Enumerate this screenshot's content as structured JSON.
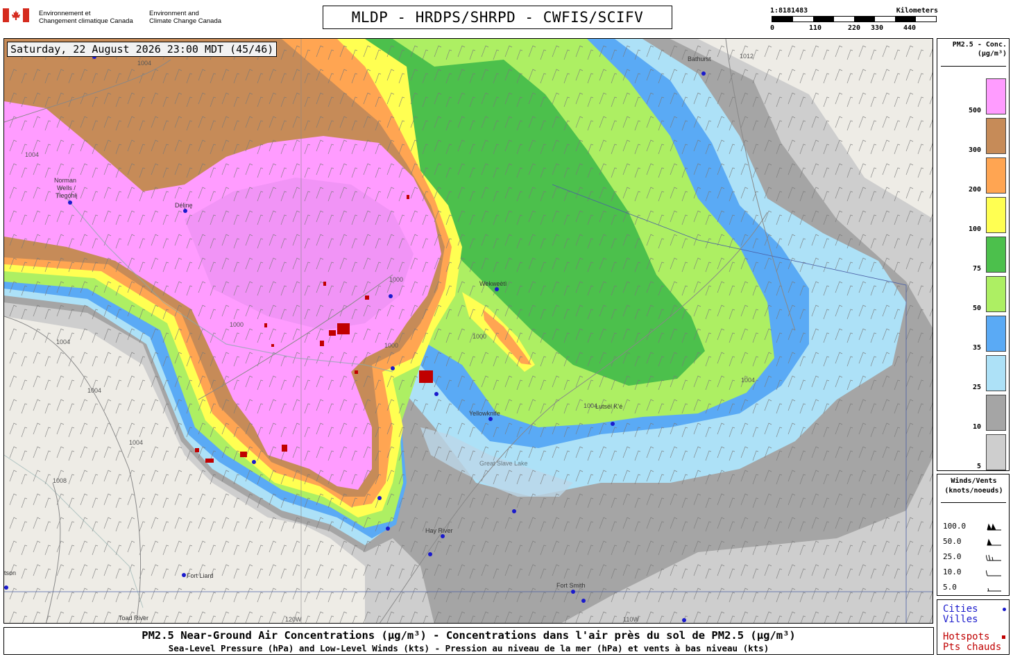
{
  "header": {
    "gov_fr_line1": "Environnement et",
    "gov_fr_line2": "Changement climatique Canada",
    "gov_en_line1": "Environment and",
    "gov_en_line2": "Climate Change Canada",
    "title": "MLDP - HRDPS/SHRPD - CWFIS/SCIFV"
  },
  "scale": {
    "ratio": "1:8181483",
    "unit": "Kilometers",
    "ticks": [
      "0",
      "110",
      "220",
      "330",
      "440"
    ]
  },
  "map": {
    "datetime": "Saturday, 22 August 2026 23:00 MDT (45/46)",
    "cities": [
      {
        "name": "Norman Wells / Tłegóhłį",
        "name_line1": "Norman",
        "name_line2": "Wells /",
        "name_line3": "Tłegóhłį"
      },
      {
        "name": "Délįnę",
        "label": "Délįnę"
      },
      {
        "name": "Wekweètì",
        "label": "Wekweètì"
      },
      {
        "name": "Yellowknife",
        "label": "Yellowknife"
      },
      {
        "name": "Łutsël K'é",
        "label": "Łutsël K'é"
      },
      {
        "name": "Hay River",
        "label": "Hay River"
      },
      {
        "name": "Fort Liard",
        "label": "Fort Liard"
      },
      {
        "name": "Fort Smith",
        "label": "Fort Smith"
      },
      {
        "name": "Bathurst Inlet",
        "label": "Bathurst"
      },
      {
        "name": "Watson Lake",
        "label": "tson"
      },
      {
        "name": "Toad River",
        "label": "Toad River"
      },
      {
        "name": "Great Slave Lake",
        "label": "Great Slave Lake"
      }
    ],
    "isobars": [
      "1004",
      "1000",
      "1008",
      "1012"
    ],
    "meridian_label": "120W",
    "meridian_label2": "110W"
  },
  "legend_pm": {
    "title_line1": "PM2.5 - Conc.",
    "title_line2": "(µg/m³)",
    "bins": [
      {
        "label": "500",
        "color": "#ff9cff"
      },
      {
        "label": "300",
        "color": "#c68b58"
      },
      {
        "label": "200",
        "color": "#ffa552"
      },
      {
        "label": "100",
        "color": "#ffff52"
      },
      {
        "label": "75",
        "color": "#4cc04c"
      },
      {
        "label": "50",
        "color": "#adef63"
      },
      {
        "label": "35",
        "color": "#5aaaf5"
      },
      {
        "label": "25",
        "color": "#ade1f7"
      },
      {
        "label": "10",
        "color": "#a5a5a5"
      },
      {
        "label": "5",
        "color": "#cecece"
      }
    ]
  },
  "legend_wind": {
    "title_line1": "Winds/Vents",
    "title_line2": "(knots/noeuds)",
    "rows": [
      "100.0",
      "50.0",
      "25.0",
      "10.0",
      "5.0"
    ]
  },
  "legend_markers": {
    "cities_line1": "Cities",
    "cities_line2": "Villes",
    "hotspots_line1": "Hotspots",
    "hotspots_line2": "Pts chauds",
    "city_color": "#1a1acc",
    "hotspot_color": "#c00000"
  },
  "footer": {
    "title": "PM2.5 Near-Ground Air Concentrations (µg/m³) - Concentrations dans l'air près du sol de PM2.5 (µg/m³)",
    "subtitle": "Sea-Level Pressure (hPa) and Low-Level Winds (kts) - Pression au niveau de la mer (hPa) et vents à bas niveau (kts)"
  }
}
